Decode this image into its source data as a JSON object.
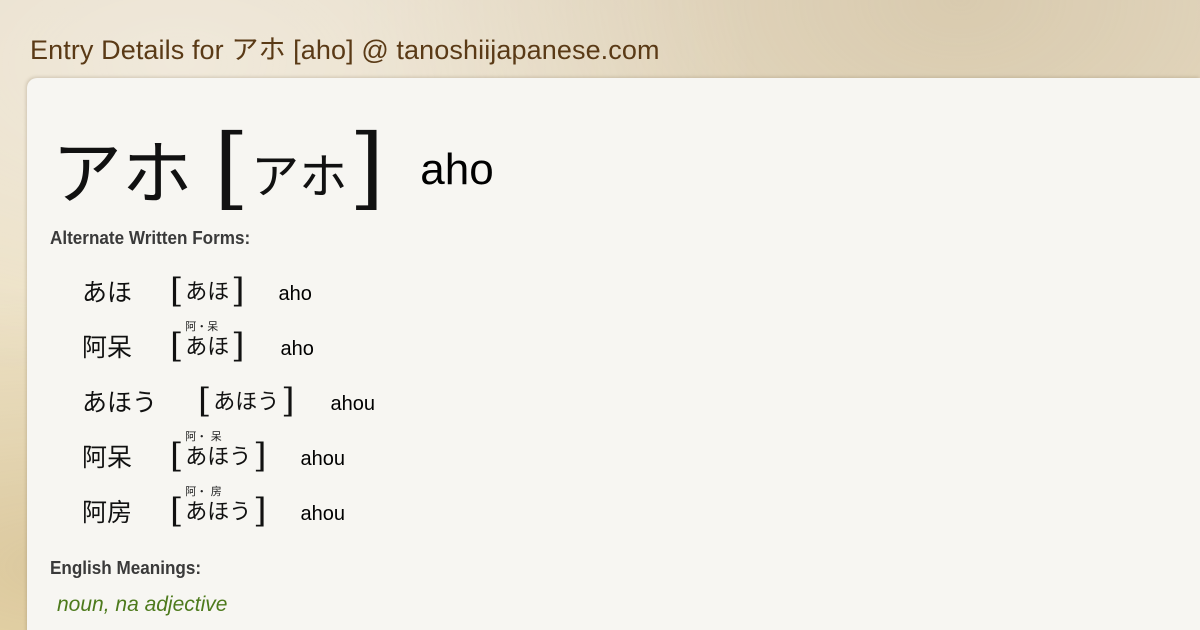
{
  "page": {
    "title": "Entry Details for アホ [aho] @ tanoshiijapanese.com"
  },
  "entry": {
    "headword": "アホ",
    "reading": "アホ",
    "romaji": "aho"
  },
  "alternate_forms": {
    "label": "Alternate Written Forms:",
    "items": [
      {
        "form": "あほ",
        "ruby": "",
        "reading": "あほ",
        "romaji": "aho"
      },
      {
        "form": "阿呆",
        "ruby": "阿・呆",
        "reading": "あほ",
        "romaji": "aho"
      },
      {
        "form": "あほう",
        "ruby": "",
        "reading": "あほう",
        "romaji": "ahou"
      },
      {
        "form": "阿呆",
        "ruby": "阿・ 呆",
        "reading": "あほう",
        "romaji": "ahou"
      },
      {
        "form": "阿房",
        "ruby": "阿・ 房",
        "reading": "あほう",
        "romaji": "ahou"
      }
    ]
  },
  "meanings": {
    "label": "English Meanings:",
    "part_of_speech": "noun, na adjective"
  },
  "colors": {
    "title": "#5a3a16",
    "part_of_speech": "#4d7a1c",
    "panel": "#f7f6f2"
  }
}
